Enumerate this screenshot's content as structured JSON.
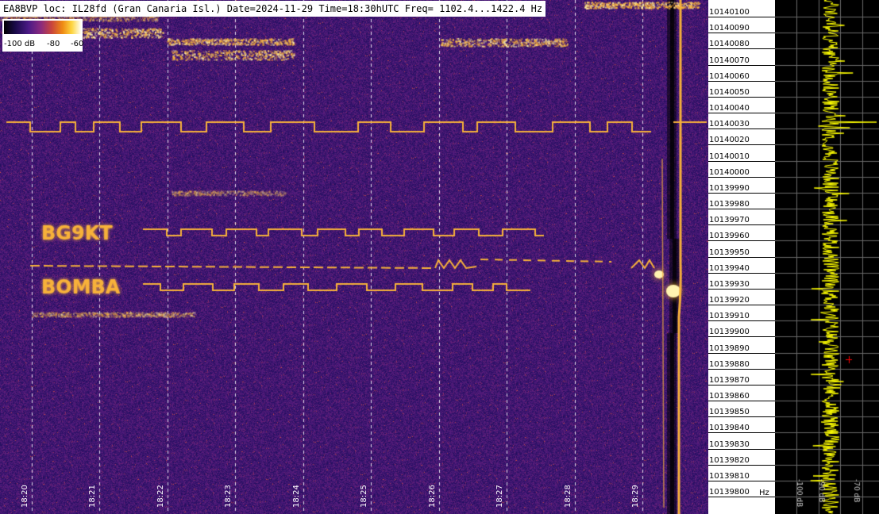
{
  "header": {
    "title": "EA8BVP loc: IL28fd (Gran Canaria Isl.) Date=2024-11-29 Time=18:30hUTC Freq= 1102.4...1422.4 Hz"
  },
  "colorbar": {
    "labels": [
      "-100 dB",
      "-80",
      "-60"
    ]
  },
  "waterfall": {
    "time_labels": [
      "18:20",
      "18:21",
      "18:22",
      "18:23",
      "18:24",
      "18:25",
      "18:26",
      "18:27",
      "18:28",
      "18:29"
    ],
    "decoded_texts": [
      "BG9KT",
      "BOMBA"
    ],
    "colors": {
      "background": "#2a1060",
      "signal": "#f7b13a",
      "peak": "#fff3b0",
      "grid": "#ffffff"
    }
  },
  "freq_axis": {
    "labels": [
      "10140100",
      "10140090",
      "10140080",
      "10140070",
      "10140060",
      "10140050",
      "10140040",
      "10140030",
      "10140020",
      "10140010",
      "10140000",
      "10139990",
      "10139980",
      "10139970",
      "10139960",
      "10139950",
      "10139940",
      "10139930",
      "10139920",
      "10139910",
      "10139900",
      "10139890",
      "10139880",
      "10139870",
      "10139860",
      "10139850",
      "10139840",
      "10139830",
      "10139820",
      "10139810",
      "10139800"
    ],
    "unit": "Hz"
  },
  "spectrum": {
    "labels": [
      "-100 dB",
      "-90 dB",
      "-70 dB"
    ],
    "colors": {
      "background": "#000000",
      "trace": "#ffff00",
      "grid": "#6a6a6a",
      "marker": "#ff0000"
    }
  }
}
